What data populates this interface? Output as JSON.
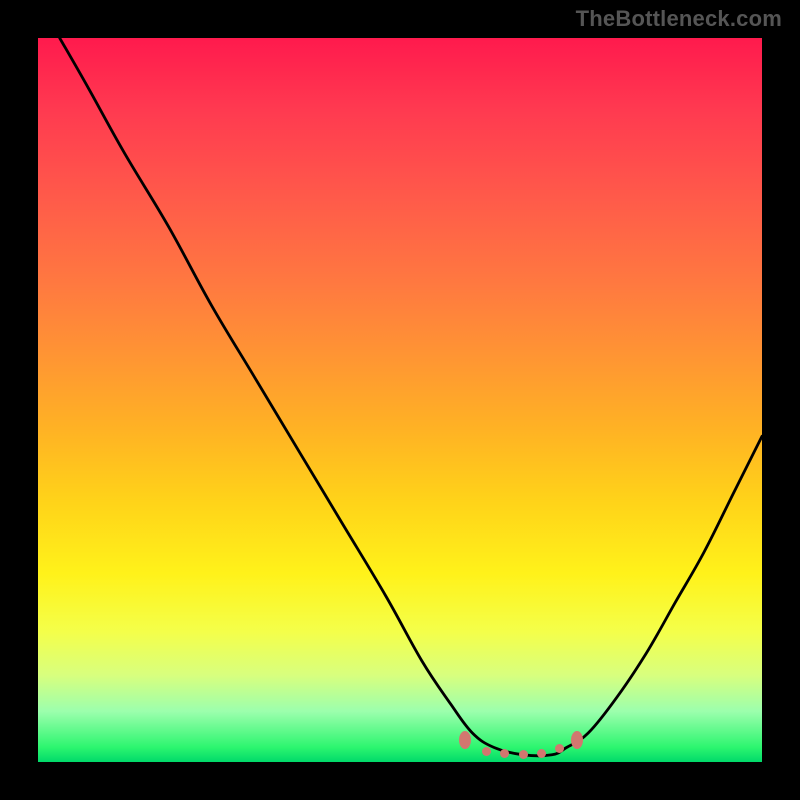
{
  "watermark": "TheBottleneck.com",
  "chart_data": {
    "type": "line",
    "title": "",
    "xlabel": "",
    "ylabel": "",
    "xlim": [
      0,
      100
    ],
    "ylim": [
      0,
      100
    ],
    "grid": false,
    "series": [
      {
        "name": "bottleneck-curve",
        "x": [
          3,
          7,
          12,
          18,
          24,
          30,
          36,
          42,
          48,
          53,
          57,
          60,
          63,
          67,
          71,
          73,
          76,
          80,
          84,
          88,
          92,
          96,
          100
        ],
        "y": [
          100,
          93,
          84,
          74,
          63,
          53,
          43,
          33,
          23,
          14,
          8,
          4,
          2,
          1,
          1,
          2,
          4,
          9,
          15,
          22,
          29,
          37,
          45
        ]
      }
    ],
    "markers": {
      "name": "optimal-range-points",
      "color": "#d2776f",
      "points": [
        {
          "x": 59,
          "y": 3,
          "size": "big"
        },
        {
          "x": 62,
          "y": 1.5,
          "size": "small"
        },
        {
          "x": 64.5,
          "y": 1.2,
          "size": "small"
        },
        {
          "x": 67,
          "y": 1.0,
          "size": "small"
        },
        {
          "x": 69.5,
          "y": 1.2,
          "size": "small"
        },
        {
          "x": 72,
          "y": 1.8,
          "size": "small"
        },
        {
          "x": 74.5,
          "y": 3,
          "size": "big"
        }
      ]
    },
    "background_gradient": {
      "top": "#ff1a4d",
      "mid": "#ffd319",
      "bottom": "#00d96a"
    }
  }
}
